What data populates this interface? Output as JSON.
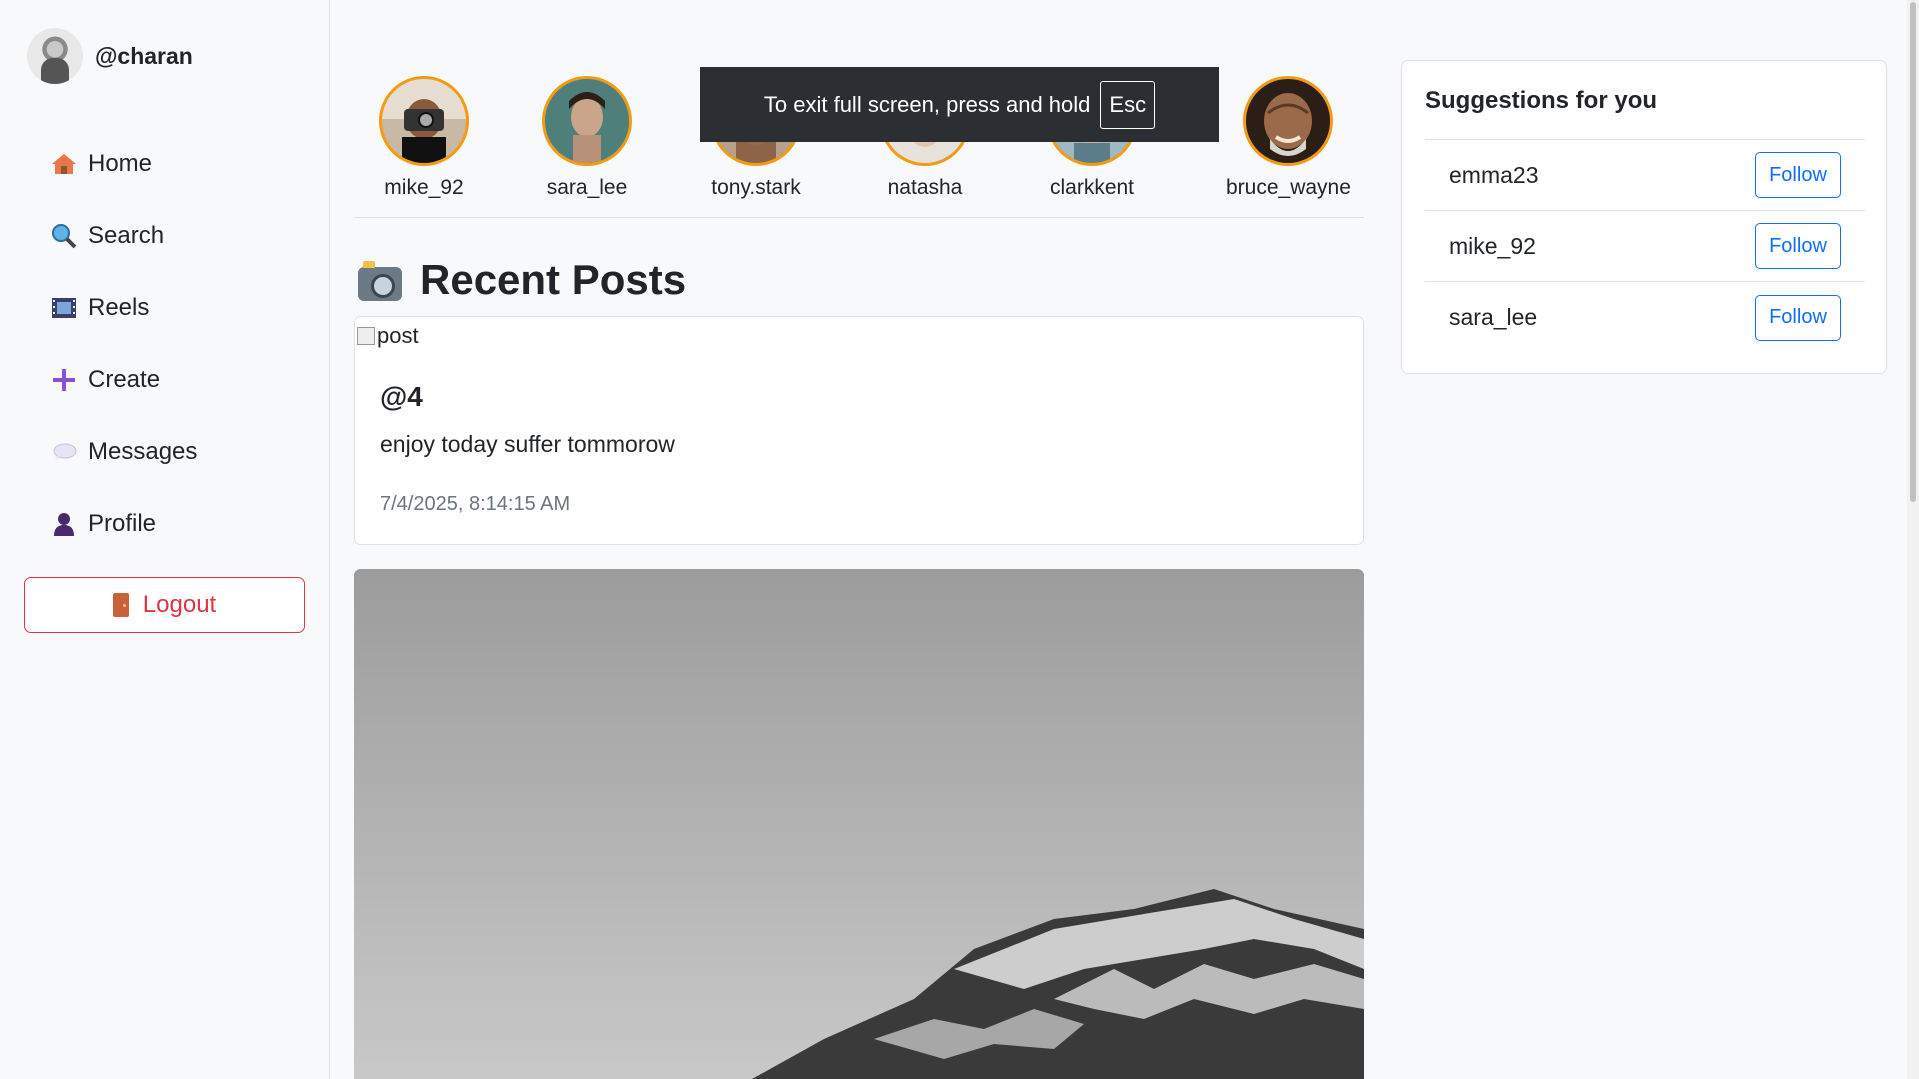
{
  "profile": {
    "username": "@charan"
  },
  "nav": [
    {
      "label": "Home",
      "icon": "home-icon"
    },
    {
      "label": "Search",
      "icon": "search-icon"
    },
    {
      "label": "Reels",
      "icon": "film-icon"
    },
    {
      "label": "Create",
      "icon": "plus-icon"
    },
    {
      "label": "Messages",
      "icon": "speech-bubble-icon"
    },
    {
      "label": "Profile",
      "icon": "person-icon"
    }
  ],
  "logout": {
    "label": "Logout"
  },
  "stories": [
    {
      "name": "mike_92"
    },
    {
      "name": "sara_lee"
    },
    {
      "name": "tony.stark"
    },
    {
      "name": "natasha"
    },
    {
      "name": "clarkkent"
    },
    {
      "name": "bruce_wayne"
    }
  ],
  "toast": {
    "text": "To exit full screen, press and hold",
    "key": "Esc"
  },
  "recent": {
    "title": "Recent Posts"
  },
  "post": {
    "image_alt": "post",
    "author": "@4",
    "caption": "enjoy today suffer tommorow",
    "time": "7/4/2025, 8:14:15 AM"
  },
  "suggestions": {
    "title": "Suggestions for you",
    "follow_label": "Follow",
    "users": [
      "emma23",
      "mike_92",
      "sara_lee"
    ]
  },
  "colors": {
    "accent": "#0d6efd",
    "danger": "#dc3545",
    "story_ring": "#f39c12"
  }
}
